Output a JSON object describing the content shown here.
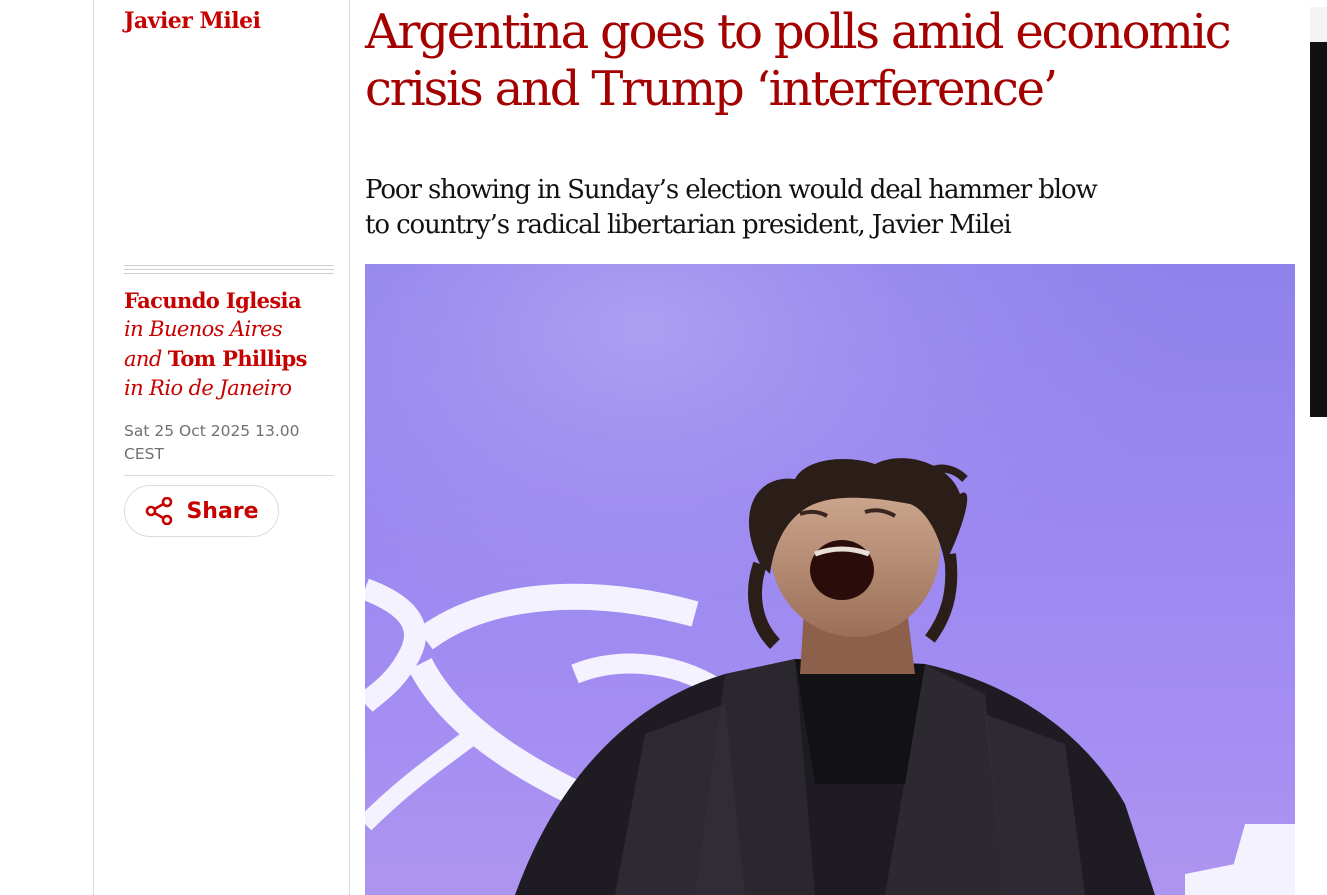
{
  "section_tag": "Javier Milei",
  "headline": {
    "line1": "Argentina goes to polls amid economic",
    "line2": "crisis and Trump ‘interference’"
  },
  "standfirst": {
    "line1": "Poor showing in Sunday’s election would deal hammer blow",
    "line2": "to country’s radical libertarian president, Javier Milei"
  },
  "byline": {
    "author1": "Facundo Iglesia",
    "location1": "in Buenos Aires",
    "conjunction": "and",
    "author2": "Tom Phillips",
    "location2": "in Rio de Janeiro"
  },
  "dateline": {
    "line1": "Sat 25 Oct 2025 13.00",
    "line2": "CEST"
  },
  "share": {
    "label": "Share",
    "icon": "share-icon"
  },
  "colors": {
    "accent": "#c70000",
    "headline": "#a40000",
    "text": "#121212",
    "meta": "#707070",
    "photo_background": "#9a88f0"
  }
}
